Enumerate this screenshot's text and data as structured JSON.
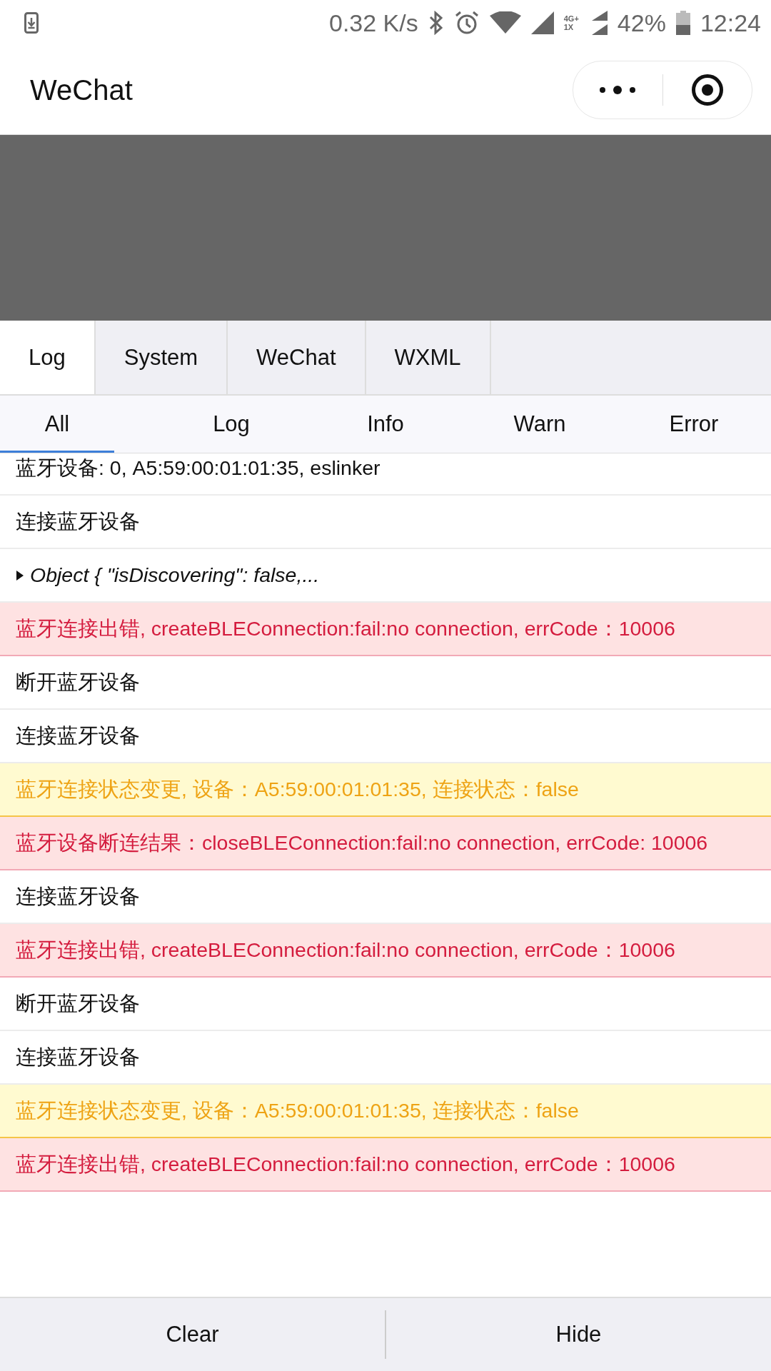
{
  "status_bar": {
    "speed": "0.32 K/s",
    "network_top": "4G+",
    "network_bottom": "1X",
    "battery": "42%",
    "time": "12:24"
  },
  "title_bar": {
    "title": "WeChat"
  },
  "tabs": [
    {
      "label": "Log",
      "selected": true
    },
    {
      "label": "System",
      "selected": false
    },
    {
      "label": "WeChat",
      "selected": false
    },
    {
      "label": "WXML",
      "selected": false
    }
  ],
  "filters": [
    {
      "label": "All",
      "selected": true
    },
    {
      "label": "Log",
      "selected": false
    },
    {
      "label": "Info",
      "selected": false
    },
    {
      "label": "Warn",
      "selected": false
    },
    {
      "label": "Error",
      "selected": false
    }
  ],
  "log_entries": [
    {
      "kind": "log",
      "text": "蓝牙设备: 0, A5:59:00:01:01:35, eslinker"
    },
    {
      "kind": "log",
      "text": "连接蓝牙设备"
    },
    {
      "kind": "object",
      "text": "Object { \"isDiscovering\": false,..."
    },
    {
      "kind": "error",
      "text": "蓝牙连接出错, createBLEConnection:fail:no connection, errCode：10006"
    },
    {
      "kind": "log",
      "text": "断开蓝牙设备"
    },
    {
      "kind": "log",
      "text": "连接蓝牙设备"
    },
    {
      "kind": "warn",
      "text": "蓝牙连接状态变更, 设备：A5:59:00:01:01:35, 连接状态：false"
    },
    {
      "kind": "error",
      "text": "蓝牙设备断连结果：closeBLEConnection:fail:no connection, errCode: 10006"
    },
    {
      "kind": "log",
      "text": "连接蓝牙设备"
    },
    {
      "kind": "error",
      "text": "蓝牙连接出错, createBLEConnection:fail:no connection, errCode：10006"
    },
    {
      "kind": "log",
      "text": "断开蓝牙设备"
    },
    {
      "kind": "log",
      "text": "连接蓝牙设备"
    },
    {
      "kind": "warn",
      "text": "蓝牙连接状态变更, 设备：A5:59:00:01:01:35, 连接状态：false"
    },
    {
      "kind": "error",
      "text": "蓝牙连接出错, createBLEConnection:fail:no connection, errCode：10006"
    }
  ],
  "bottom_buttons": [
    "Clear",
    "Hide"
  ]
}
